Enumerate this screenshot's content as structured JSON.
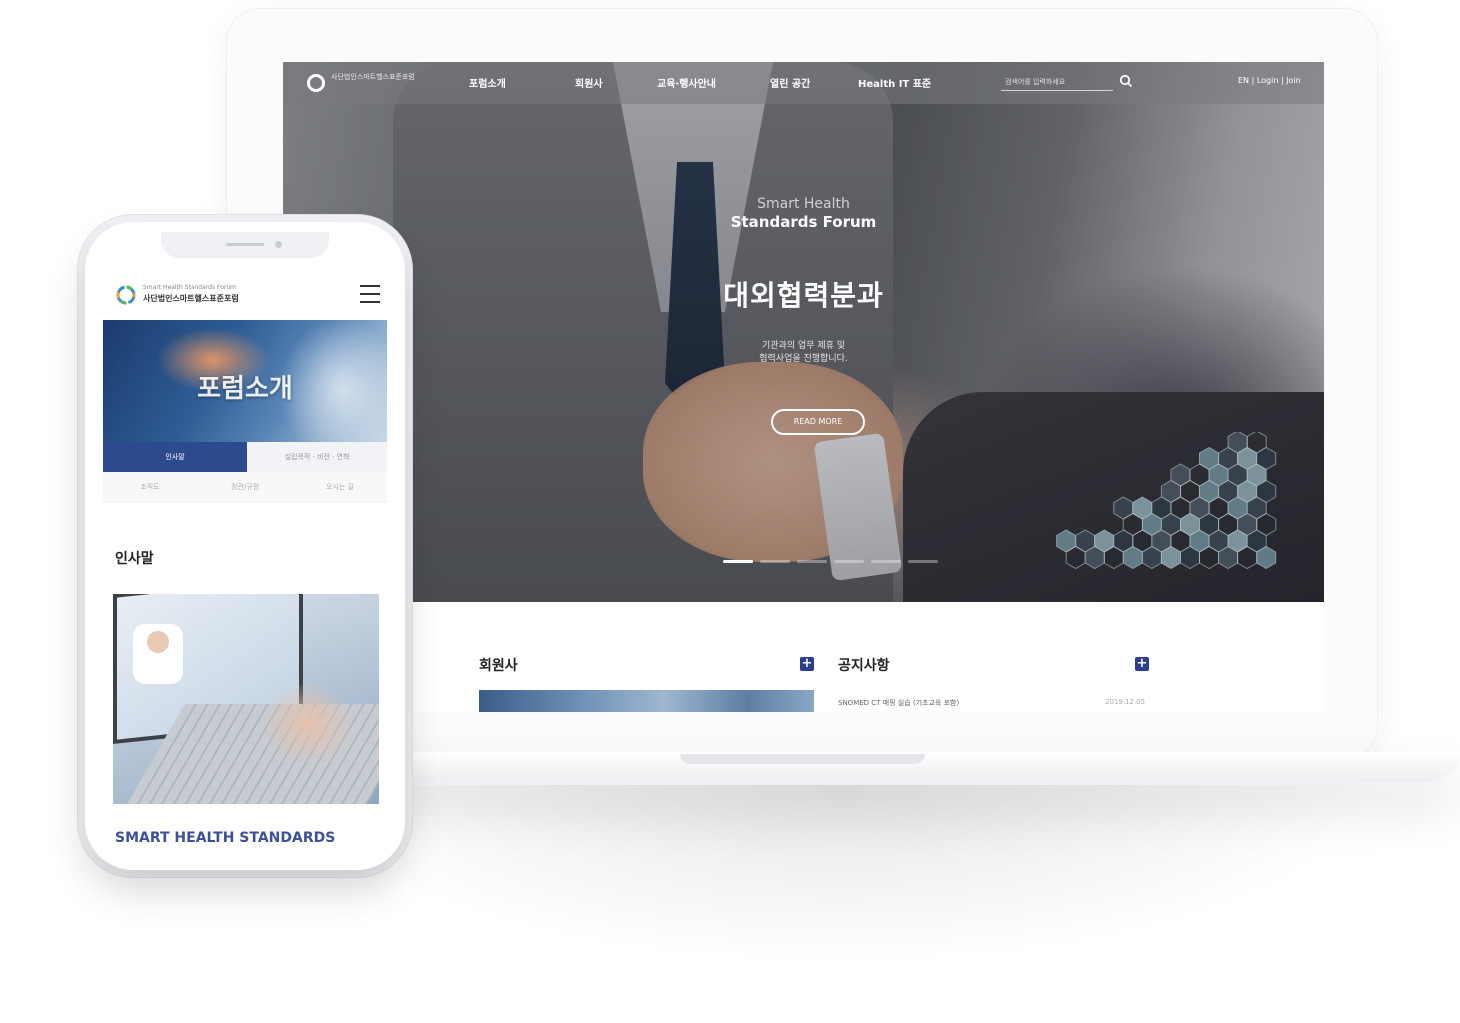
{
  "desktop": {
    "nav": {
      "logo_text": "사단법인스마트헬스표준포럼",
      "menu": [
        "포럼소개",
        "회원사",
        "교육·행사안내",
        "열린 공간",
        "Health IT 표준"
      ],
      "search_placeholder": "검색어를 입력하세요",
      "util": "EN | Login | Join"
    },
    "hero": {
      "subtitle_line1": "Smart Health",
      "subtitle_line2": "Standards Forum",
      "title": "대외협력분과",
      "desc_line1": "기관과의 업무 제휴 및",
      "desc_line2": "협력사업을 진행합니다.",
      "button": "READ MORE",
      "slides": 6,
      "active_slide": 1
    },
    "members": {
      "title": "회원사"
    },
    "notices": {
      "title": "공지사항",
      "items": [
        {
          "text": "SNOMED CT 매핑 실습 (기초교육 포함)",
          "date": "2019.12.05"
        }
      ]
    }
  },
  "mobile": {
    "brand_en": "Smart Health Standards Forum",
    "brand_ko": "사단법인스마트헬스표준포럼",
    "hero_title": "포럼소개",
    "tabs": [
      "인사말",
      "설립목적 · 비전 · 연혁"
    ],
    "subtabs": [
      "조직도",
      "정관/규정",
      "오시는 길"
    ],
    "section_title": "인사말",
    "footer_title": "SMART HEALTH STANDARDS"
  },
  "colors": {
    "accent": "#2e4a8f",
    "plus": "#2a3f8f"
  }
}
